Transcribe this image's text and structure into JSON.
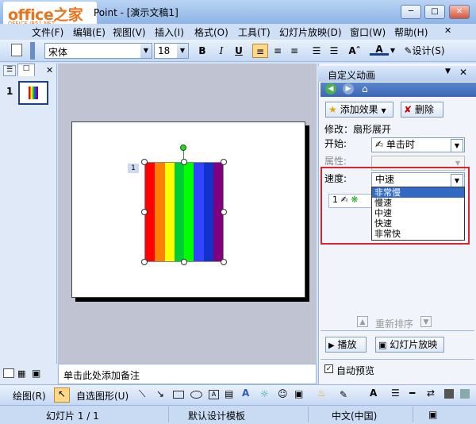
{
  "window": {
    "title": "Point - [演示文稿1]",
    "logo_main": "office之家",
    "logo_sub": "OFFICE.JB51.NET"
  },
  "menu": [
    "文件(F)",
    "编辑(E)",
    "视图(V)",
    "插入(I)",
    "格式(O)",
    "工具(T)",
    "幻灯片放映(D)",
    "窗口(W)",
    "帮助(H)"
  ],
  "toolbar": {
    "font_name": "宋体",
    "font_size": "18",
    "bold": "B",
    "italic": "I",
    "underline": "U",
    "design": "设计(S)"
  },
  "slides_panel": {
    "slide_number": "1"
  },
  "slide": {
    "animation_tag": "1",
    "rainbow_colors": [
      "#ff0000",
      "#ff7f00",
      "#ffff00",
      "#00cc33",
      "#00ff00",
      "#3344ff",
      "#1133cc",
      "#800080"
    ]
  },
  "notes": {
    "placeholder": "单击此处添加备注"
  },
  "task_pane": {
    "title": "自定义动画",
    "add_effect": "添加效果",
    "delete": "删除",
    "modify_label": "修改：扇形展开",
    "start_label": "开始:",
    "start_value": "单击时",
    "property_label": "属性:",
    "speed_label": "速度:",
    "speed_value": "中速",
    "speed_options": [
      "非常慢",
      "慢速",
      "中速",
      "快速",
      "非常快"
    ],
    "list_item_num": "1",
    "reorder": "重新排序",
    "play": "播放",
    "slideshow": "幻灯片放映",
    "autopreview": "自动预览"
  },
  "draw_toolbar": {
    "draw": "绘图(R)",
    "autoshapes": "自选图形(U)"
  },
  "status": {
    "slide": "幻灯片 1 / 1",
    "template": "默认设计模板",
    "language": "中文(中国)"
  }
}
